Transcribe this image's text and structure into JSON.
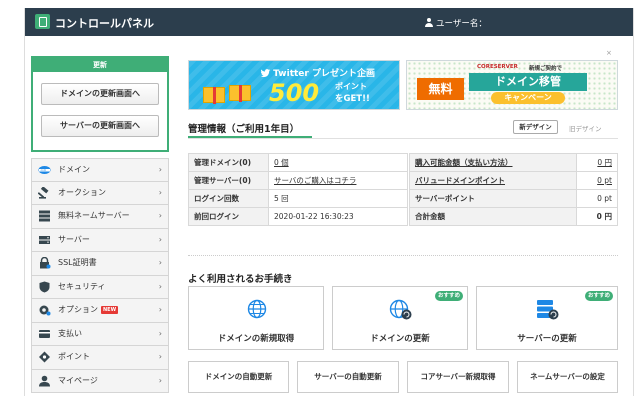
{
  "header": {
    "title": "コントロールパネル",
    "user_label": "ユーザー名："
  },
  "update_box": {
    "title": "更新",
    "domain_button": "ドメインの更新画面へ",
    "server_button": "サーバーの更新画面へ"
  },
  "sidebar": {
    "items": [
      {
        "label": "ドメイン",
        "icon": "domain-icon"
      },
      {
        "label": "オークション",
        "icon": "auction-gavel-icon"
      },
      {
        "label": "無料ネームサーバー",
        "icon": "nameserver-icon"
      },
      {
        "label": "サーバー",
        "icon": "server-icon"
      },
      {
        "label": "SSL証明書",
        "icon": "ssl-lock-icon"
      },
      {
        "label": "セキュリティ",
        "icon": "shield-icon"
      },
      {
        "label": "オプション",
        "icon": "option-gear-icon",
        "badge": "NEW"
      },
      {
        "label": "支払い",
        "icon": "payment-icon"
      },
      {
        "label": "ポイント",
        "icon": "point-icon"
      },
      {
        "label": "マイページ",
        "icon": "mypage-user-icon"
      }
    ],
    "arrow": "›"
  },
  "banners": {
    "twitter": {
      "heading": "Twitter プレゼント企画",
      "number": "500",
      "line1": "ポイント",
      "line2": "をGET!!"
    },
    "domain": {
      "brand": "CORESERVER",
      "subtitle": "新規ご契約で",
      "free": "無料",
      "main": "ドメイン移管",
      "campaign": "キャンペーン"
    },
    "close": "×"
  },
  "info": {
    "title": "管理情報（ご利用1年目）",
    "design_new": "新デザイン",
    "design_old": "旧デザイン",
    "left_rows": [
      {
        "label": "管理ドメイン(0)",
        "value": "0 個"
      },
      {
        "label": "管理サーバー(0)",
        "value": "サーバのご購入はコチラ"
      },
      {
        "label": "ログイン回数",
        "value": "5 回"
      },
      {
        "label": "前回ログイン",
        "value": "2020-01-22 16:30:23"
      }
    ],
    "right_rows": [
      {
        "label": "購入可能金額（支払い方法）",
        "value": "0 円"
      },
      {
        "label": "バリュードメインポイント",
        "value": "0 pt"
      },
      {
        "label": "サーバーポイント",
        "value": "0 pt"
      },
      {
        "label": "合計金額",
        "value": "0 円"
      }
    ]
  },
  "procedures": {
    "title": "よく利用されるお手続き",
    "recommend": "おすすめ",
    "cards": [
      {
        "label": "ドメインの新規取得"
      },
      {
        "label": "ドメインの更新"
      },
      {
        "label": "サーバーの更新"
      }
    ],
    "buttons": [
      "ドメインの自動更新",
      "サーバーの自動更新",
      "コアサーバー新規取得",
      "ネームサーバーの設定"
    ]
  },
  "colors": {
    "header_bg": "#2c3e4d",
    "accent": "#3fae77",
    "twitter_bg": "#29b6e8",
    "badge": "#e53935"
  }
}
